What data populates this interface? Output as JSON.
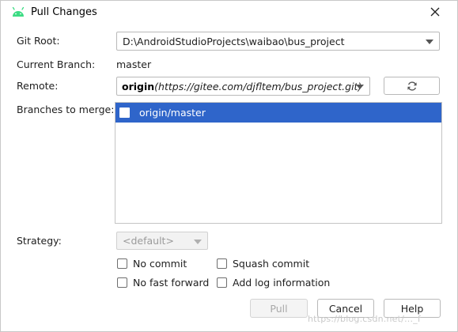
{
  "window": {
    "title": "Pull Changes"
  },
  "git_root": {
    "label": "Git Root:",
    "value": "D:\\AndroidStudioProjects\\waibao\\bus_project"
  },
  "current_branch": {
    "label": "Current Branch:",
    "value": "master"
  },
  "remote": {
    "label": "Remote:",
    "name": "origin",
    "url": "(https://gitee.com/djfltem/bus_project.git)"
  },
  "branches": {
    "label": "Branches to merge:",
    "items": [
      {
        "label": "origin/master",
        "checked": false,
        "selected": true
      }
    ]
  },
  "strategy": {
    "label": "Strategy:",
    "value": "<default>",
    "enabled": false
  },
  "options": {
    "no_commit": "No commit",
    "squash_commit": "Squash commit",
    "no_fast_forward": "No fast forward",
    "add_log_information": "Add log information"
  },
  "buttons": {
    "pull": "Pull",
    "cancel": "Cancel",
    "help": "Help"
  },
  "watermark": "https://blog.csdn.net/..._f",
  "colors": {
    "selection": "#2f65ca",
    "android_green": "#3ddc84"
  }
}
